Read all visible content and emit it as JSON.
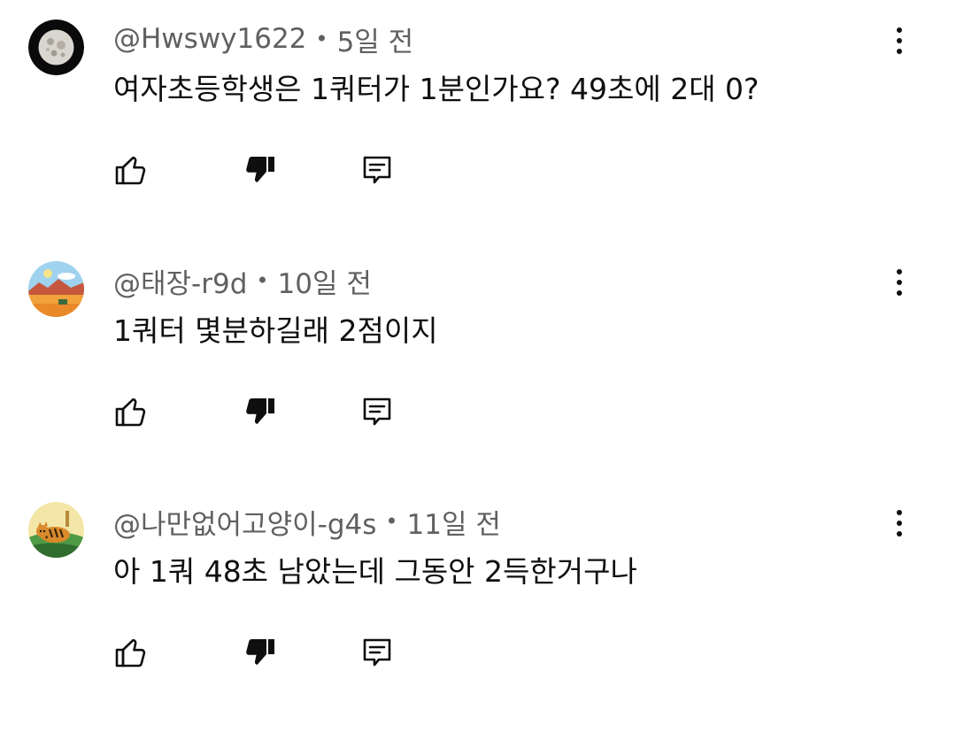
{
  "comments": [
    {
      "handle": "@Hwswy1622",
      "separator": "•",
      "age": "5일 전",
      "text": "여자초등학생은 1쿼터가 1분인가요? 49초에 2대 0?",
      "avatar_icon": "moon-avatar"
    },
    {
      "handle": "@태장-r9d",
      "separator": "•",
      "age": "10일 전",
      "text": "1쿼터 몇분하길래 2점이지",
      "avatar_icon": "landscape-avatar"
    },
    {
      "handle": "@나만없어고양이-g4s",
      "separator": "•",
      "age": "11일 전",
      "text": "아 1쿼 48초 남았는데 그동안 2득한거구나",
      "avatar_icon": "cat-avatar"
    }
  ],
  "icons": {
    "like": "thumbs-up-icon",
    "dislike": "thumbs-down-icon",
    "reply": "reply-icon",
    "more": "more-vert-icon"
  }
}
